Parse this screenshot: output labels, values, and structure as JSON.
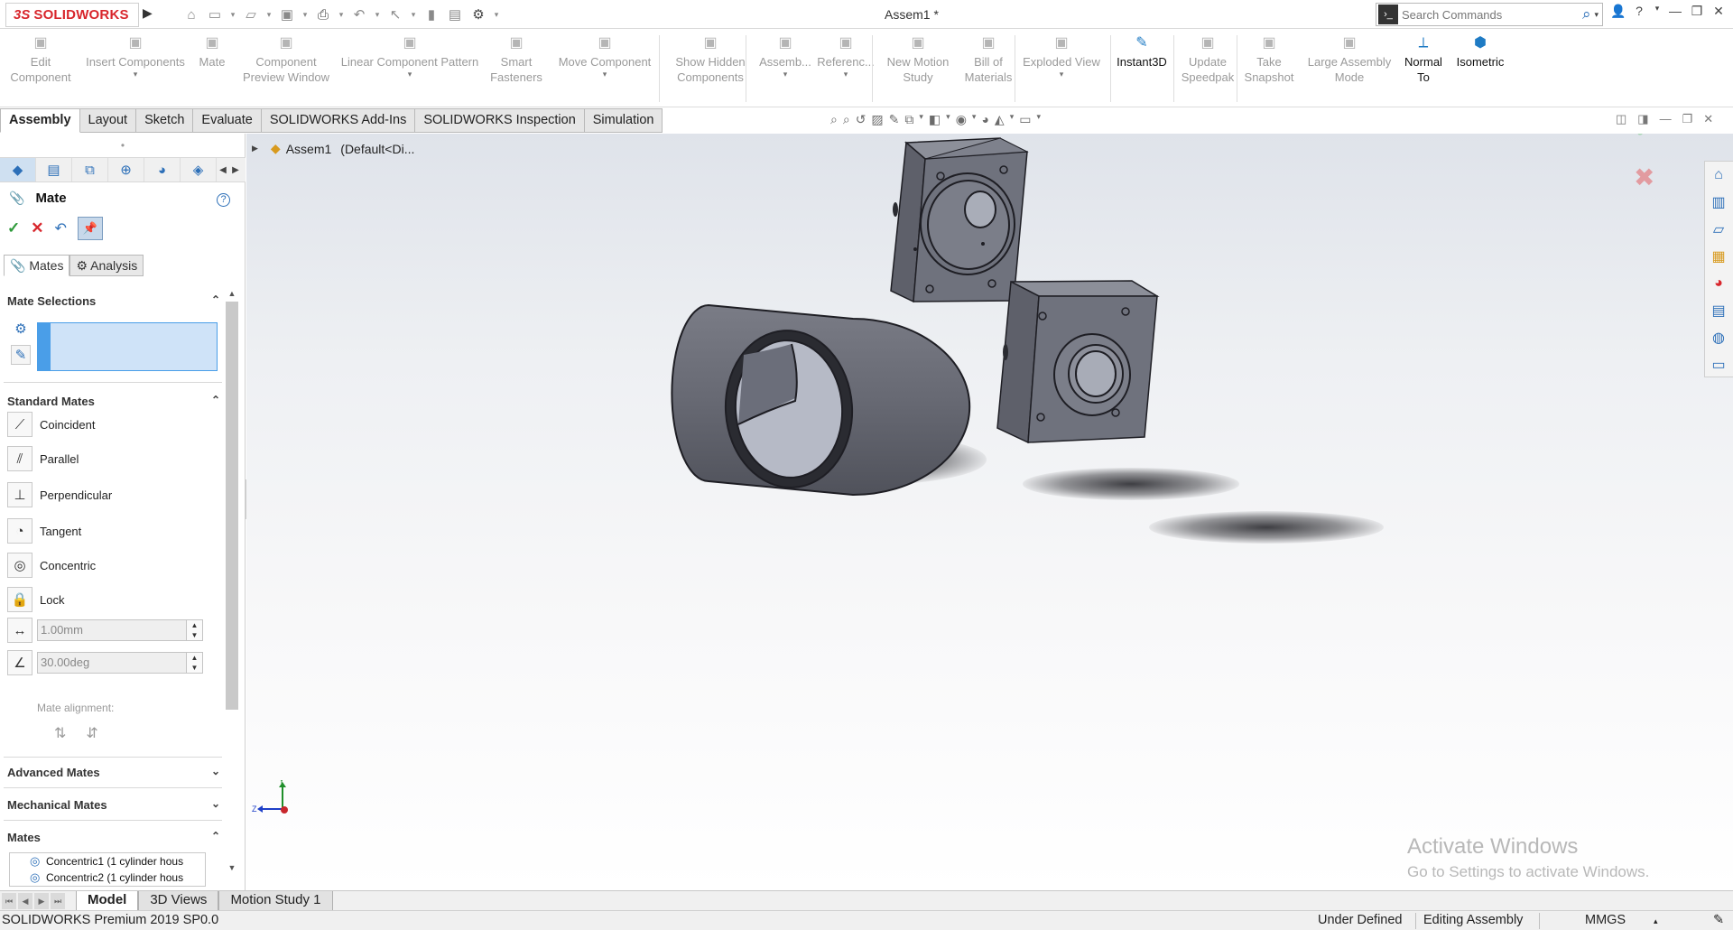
{
  "app": {
    "logo_ds": "3S",
    "logo_text": "SOLIDWORKS",
    "doc_title": "Assem1 *",
    "search_placeholder": "Search Commands"
  },
  "title_controls": [
    "user-icon",
    "help-icon",
    "minimize-icon",
    "restore-icon",
    "close-icon"
  ],
  "command_manager": [
    {
      "label": "Edit\nComponent",
      "icon": "edit-component-icon",
      "enabled": false
    },
    {
      "label": "Insert Components",
      "icon": "insert-components-icon",
      "enabled": false,
      "dropdown": true
    },
    {
      "label": "Mate",
      "icon": "mate-icon",
      "enabled": false
    },
    {
      "label": "Component\nPreview Window",
      "icon": "preview-window-icon",
      "enabled": false
    },
    {
      "label": "Linear Component Pattern",
      "icon": "linear-pattern-icon",
      "enabled": false,
      "dropdown": true
    },
    {
      "label": "Smart\nFasteners",
      "icon": "smart-fasteners-icon",
      "enabled": false
    },
    {
      "label": "Move Component",
      "icon": "move-component-icon",
      "enabled": false,
      "dropdown": true
    },
    {
      "label": "Show Hidden\nComponents",
      "icon": "show-hidden-icon",
      "enabled": false
    },
    {
      "label": "Assemb...",
      "icon": "assembly-features-icon",
      "enabled": false,
      "dropdown": true
    },
    {
      "label": "Referenc...",
      "icon": "reference-geometry-icon",
      "enabled": false,
      "dropdown": true
    },
    {
      "label": "New Motion\nStudy",
      "icon": "motion-study-icon",
      "enabled": false
    },
    {
      "label": "Bill of\nMaterials",
      "icon": "bom-icon",
      "enabled": false
    },
    {
      "label": "Exploded View",
      "icon": "exploded-view-icon",
      "enabled": false,
      "dropdown": true
    },
    {
      "label": "Instant3D",
      "icon": "instant3d-icon",
      "enabled": true
    },
    {
      "label": "Update\nSpeedpak",
      "icon": "speedpak-icon",
      "enabled": false
    },
    {
      "label": "Take\nSnapshot",
      "icon": "snapshot-icon",
      "enabled": false
    },
    {
      "label": "Large Assembly\nMode",
      "icon": "large-assembly-icon",
      "enabled": false
    },
    {
      "label": "Normal\nTo",
      "icon": "normal-to-icon",
      "enabled": true
    },
    {
      "label": "Isometric",
      "icon": "isometric-icon",
      "enabled": true
    }
  ],
  "cm_tabs": [
    "Assembly",
    "Layout",
    "Sketch",
    "Evaluate",
    "SOLIDWORKS Add-Ins",
    "SOLIDWORKS Inspection",
    "Simulation"
  ],
  "cm_active_tab": "Assembly",
  "property_manager": {
    "title": "Mate",
    "subtabs": [
      "Mates",
      "Analysis"
    ],
    "sections": {
      "mate_selections": "Mate Selections",
      "standard_mates": "Standard Mates",
      "advanced_mates": "Advanced Mates",
      "mechanical_mates": "Mechanical Mates",
      "mates": "Mates"
    },
    "standard_mates": [
      "Coincident",
      "Parallel",
      "Perpendicular",
      "Tangent",
      "Concentric",
      "Lock"
    ],
    "distance_value": "1.00mm",
    "angle_value": "30.00deg",
    "mate_alignment_label": "Mate alignment:",
    "mates_list": [
      "Concentric1 (1 cylinder hous",
      "Concentric2 (1 cylinder hous"
    ]
  },
  "graphics": {
    "tree_root": "Assem1",
    "tree_config": "(Default<Di...",
    "triad": {
      "y": "Y",
      "z": "Z"
    },
    "watermark_title": "Activate Windows",
    "watermark_sub": "Go to Settings to activate Windows."
  },
  "bottom_tabs": [
    "Model",
    "3D Views",
    "Motion Study 1"
  ],
  "bottom_active": "Model",
  "status": {
    "product": "SOLIDWORKS Premium 2019 SP0.0",
    "state": "Under Defined",
    "mode": "Editing Assembly",
    "units": "MMGS"
  },
  "colors": {
    "brand_red": "#d8262c",
    "accent_blue": "#2c6fb8",
    "part_gray": "#6e7079",
    "selection_fill": "#cfe3f8"
  }
}
